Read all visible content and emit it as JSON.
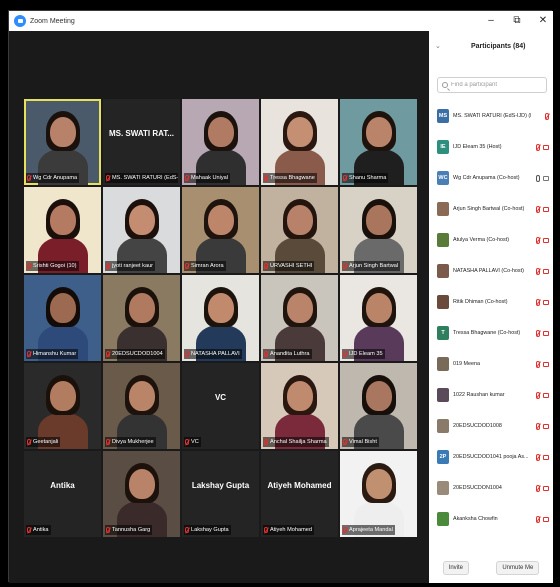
{
  "window": {
    "title": "Zoom Meeting",
    "controls": {
      "minimize": "–",
      "restore": "⧉",
      "close": "✕"
    }
  },
  "tiles": [
    {
      "label": "Wg Cdr Anupama",
      "active": true,
      "skin": "#b8826a",
      "hair": "#1a110c",
      "shirt": "#3b3b3b",
      "bg": "#4b5a6a"
    },
    {
      "label": "MS. SWATI RATURI (EdS-IJD...",
      "big": "MS. SWATI RAT...",
      "bg": "#242424"
    },
    {
      "label": "Mahaak Uniyal",
      "skin": "#b07b62",
      "hair": "#1c120d",
      "shirt": "#2f2f2f",
      "bg": "#b7a8b4"
    },
    {
      "label": "Tressa Bhagwane",
      "skin": "#c58f73",
      "hair": "#2a1710",
      "shirt": "#8a5a4a",
      "bg": "#e8e3dc"
    },
    {
      "label": "Shanu Sharma",
      "skin": "#b98469",
      "hair": "#1d120c",
      "shirt": "#1f1f1f",
      "bg": "#6f9aa0"
    },
    {
      "label": "Srishti Gogoi (10)",
      "skin": "#b57a62",
      "hair": "#1a0f0a",
      "shirt": "#7a1f2a",
      "bg": "#f0e6cc"
    },
    {
      "label": "jyoti ranjeet kaur",
      "skin": "#c48c70",
      "hair": "#1b100b",
      "shirt": "#444",
      "bg": "#d9dbdc"
    },
    {
      "label": "Simran Arora",
      "skin": "#bd866a",
      "hair": "#1f130d",
      "shirt": "#3a3a3a",
      "bg": "#a88f6f"
    },
    {
      "label": "URVASHI SETHI",
      "skin": "#b7816a",
      "hair": "#23150e",
      "shirt": "#5a4a3a",
      "bg": "#c0b29e"
    },
    {
      "label": "Arjun Singh Bartwal",
      "skin": "#a9755c",
      "hair": "#17100b",
      "shirt": "#6a6a6a",
      "bg": "#d8d2c6"
    },
    {
      "label": "Himanshu Kumar",
      "skin": "#9c6a50",
      "hair": "#120b08",
      "shirt": "#2d4a7a",
      "bg": "#3e5f8a"
    },
    {
      "label": "20EDSUCDOD1004",
      "skin": "#b07a60",
      "hair": "#1b110b",
      "shirt": "#3a3030",
      "bg": "#8a7a62"
    },
    {
      "label": "NATASHA PALLAVI",
      "skin": "#c18a6d",
      "hair": "#1d130d",
      "shirt": "#233a5a",
      "bg": "#e6e4df"
    },
    {
      "label": "Anandita Luthra",
      "skin": "#b9846a",
      "hair": "#20140e",
      "shirt": "#4a3a3a",
      "bg": "#c9c4bc"
    },
    {
      "label": "IJD Eleam 35",
      "skin": "#b98468",
      "hair": "#1f130d",
      "shirt": "#5a3a5a",
      "bg": "#eae6e2"
    },
    {
      "label": "Geetanjali",
      "skin": "#b27c61",
      "hair": "#1b110b",
      "shirt": "#6a3a2a",
      "bg": "#2a2a2a"
    },
    {
      "label": "Divya Mukherjee",
      "skin": "#ba8468",
      "hair": "#1d120c",
      "shirt": "#333",
      "bg": "#6a5a4a"
    },
    {
      "label": "VC",
      "big": "VC",
      "bg": "#242424"
    },
    {
      "label": "Anchal Shailja Sharma",
      "skin": "#c08a6e",
      "hair": "#2a170f",
      "shirt": "#7a2a3a",
      "bg": "#d7c9b9"
    },
    {
      "label": "Vimal Bisht",
      "skin": "#a97660",
      "hair": "#170f0a",
      "shirt": "#4a4a4a",
      "bg": "#bfb8ae"
    },
    {
      "label": "Antika",
      "big": "Antika",
      "bg": "#242424"
    },
    {
      "label": "Tannusha Garg",
      "skin": "#b9836a",
      "hair": "#1c110b",
      "shirt": "#3a2a2a",
      "bg": "#5a4e44"
    },
    {
      "label": "Lakshay Gupta",
      "big": "Lakshay Gupta",
      "bg": "#242424"
    },
    {
      "label": "Atiyeh Mohamed",
      "big": "Atiyeh Mohamed",
      "bg": "#242424"
    },
    {
      "label": "Aprajeeta Mandal",
      "skin": "#c09070",
      "hair": "#2a1a12",
      "shirt": "#eee",
      "bg": "#f2f2f2"
    }
  ],
  "panel": {
    "title": "Participants (84)",
    "search_placeholder": "Find a participant",
    "participants": [
      {
        "initials": "MS",
        "color": "#3a6ea5",
        "name": "MS. SWATI RATURI (EdS-IJD) (Me)",
        "mic": "off",
        "cam": ""
      },
      {
        "initials": "IE",
        "color": "#2f8f7f",
        "name": "IJD Eleam 35 (Host)",
        "mic": "off",
        "cam": "off"
      },
      {
        "initials": "WC",
        "color": "#4a7fb5",
        "name": "Wg Cdr Anupama (Co-host)",
        "mic": "on",
        "cam": "on"
      },
      {
        "photo": "#8a6a55",
        "name": "Arjun Singh Bartwal (Co-host)",
        "mic": "off",
        "cam": "off"
      },
      {
        "photo": "#5a7a3a",
        "name": "Atulya Verma (Co-host)",
        "mic": "off",
        "cam": "off"
      },
      {
        "photo": "#7a5a4a",
        "name": "NATASHA PALLAVI (Co-host)",
        "mic": "off",
        "cam": "off"
      },
      {
        "photo": "#6a4a3a",
        "name": "Ritik Dhiman (Co-host)",
        "mic": "off",
        "cam": "off"
      },
      {
        "initials": "T",
        "color": "#2f7f5f",
        "name": "Tressa Bhagwane (Co-host)",
        "mic": "off",
        "cam": "off"
      },
      {
        "photo": "#7a6a5a",
        "name": "019 Meena",
        "mic": "off",
        "cam": "off"
      },
      {
        "photo": "#5a4a5a",
        "name": "1022 Raushan kumar",
        "mic": "off",
        "cam": "off"
      },
      {
        "photo": "#8a7a6a",
        "name": "20EDSUCDOD1008",
        "mic": "off",
        "cam": "off"
      },
      {
        "initials": "2P",
        "color": "#3a7ab5",
        "name": "20EDSUCDOD1041 pooja As...",
        "mic": "off",
        "cam": "off"
      },
      {
        "photo": "#9a8a7a",
        "name": "20EDSUCDON1004",
        "mic": "off",
        "cam": "off"
      },
      {
        "photo": "#4a8a3a",
        "name": "Akanksha Chowfin",
        "mic": "off",
        "cam": "off"
      }
    ],
    "invite_label": "Invite",
    "unmute_label": "Unmute Me"
  }
}
